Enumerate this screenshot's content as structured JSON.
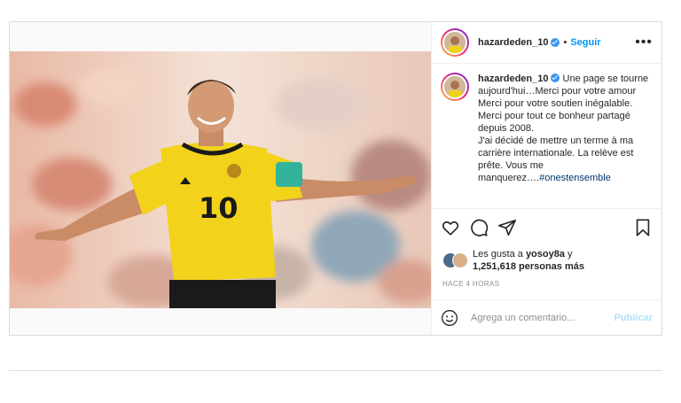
{
  "post": {
    "username": "hazardeden_10",
    "follow_label": "Seguir",
    "separator": "•",
    "more_label": "•••",
    "caption_lines": [
      "Une page se tourne aujourd'hui…Merci pour votre amour",
      "Merci pour votre soutien inégalable.",
      "Merci pour tout ce bonheur partagé depuis 2008.",
      "J'ai décidé de mettre un terme à ma carrière internationale. La relève est prête. Vous me manquerez…."
    ],
    "hashtag": "#onestensemble",
    "likes_prefix": "Les gusta a",
    "likes_user": "yosoy8a",
    "likes_connector": "y",
    "likes_count": "1,251,618 personas más",
    "timestamp": "HACE 4 HORAS",
    "comment_placeholder": "Agrega un comentario...",
    "publish_label": "Publicar"
  },
  "colors": {
    "verified": "#3897f0",
    "follow": "#0095f6",
    "publish_disabled": "#b2dffc",
    "jersey": "#f2d21b"
  },
  "icons": [
    "verified-icon",
    "more-options-icon",
    "heart-icon",
    "comment-icon",
    "share-icon",
    "bookmark-icon",
    "emoji-icon"
  ]
}
